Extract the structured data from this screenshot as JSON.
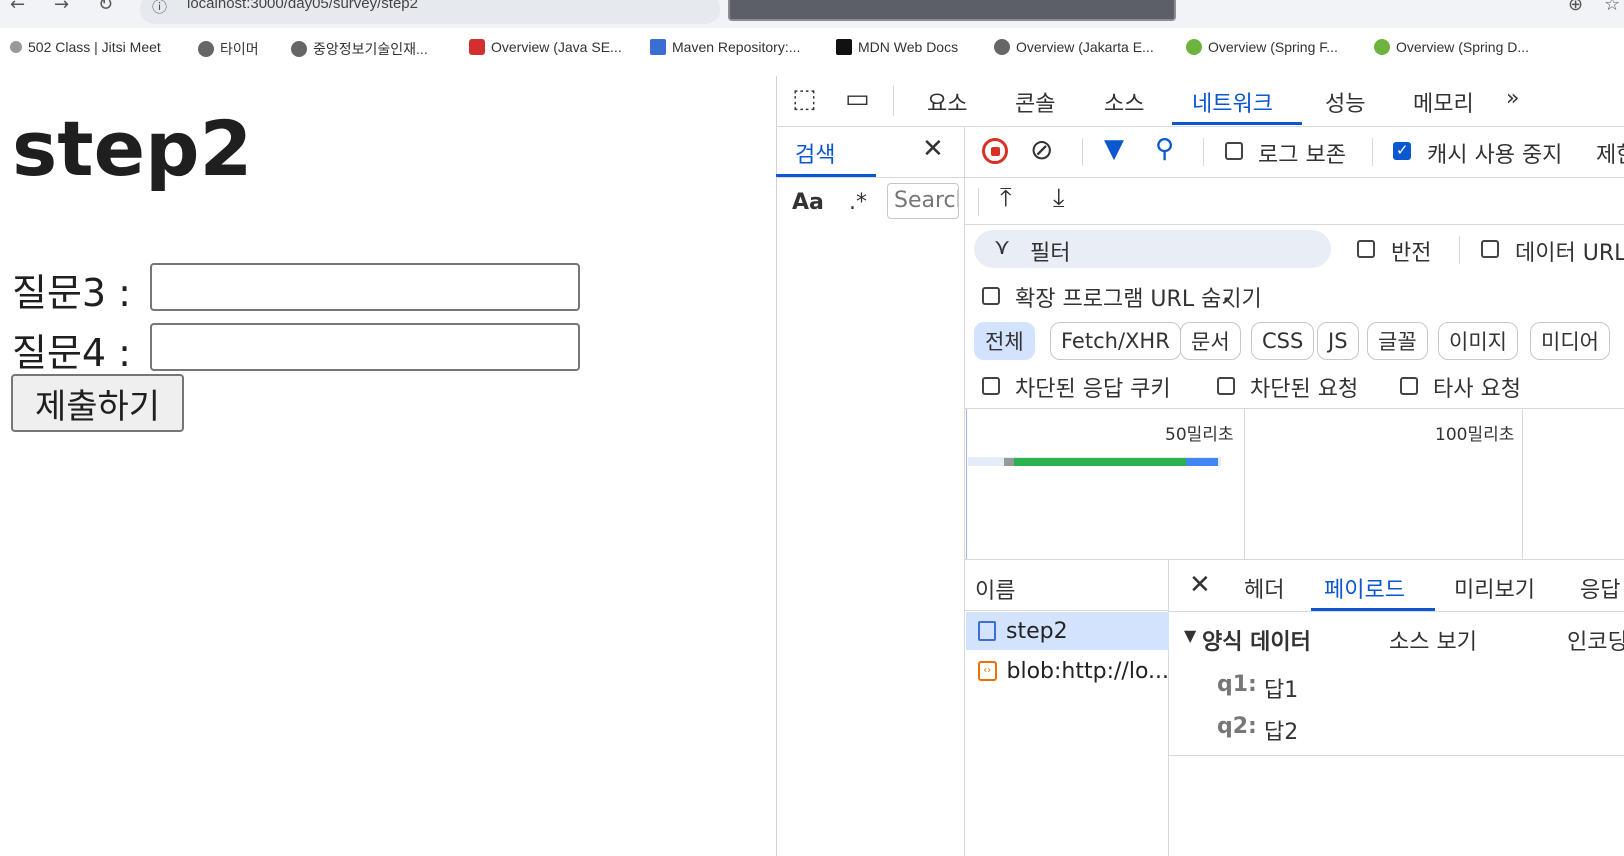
{
  "browser": {
    "url": "localhost:3000/day05/survey/step2",
    "bookmarks": [
      "502 Class | Jitsi Meet",
      "타이머",
      "중앙정보기술인재...",
      "Overview (Java SE...",
      "Maven Repository:...",
      "MDN Web Docs",
      "Overview (Jakarta E...",
      "Overview (Spring F...",
      "Overview (Spring D..."
    ]
  },
  "page": {
    "title": "step2",
    "q3_label": "질문3 :",
    "q4_label": "질문4 :",
    "submit_label": "제출하기"
  },
  "devtools": {
    "tabs": [
      "요소",
      "콘솔",
      "소스",
      "네트워크",
      "성능",
      "메모리"
    ],
    "active_tab": "네트워크",
    "search_panel": {
      "title": "검색",
      "case_label": "Aa",
      "regex_label": ".*",
      "placeholder": "Search"
    },
    "toolbar": {
      "preserve_log": "로그 보존",
      "disable_cache": "캐시 사용 중지",
      "disable_cache_checked": true,
      "throttle_partial": "제한"
    },
    "filter": {
      "placeholder": "필터",
      "invert": "반전",
      "hide_data_urls": "데이터 URL",
      "hide_extension_urls": "확장 프로그램 URL 숨기기"
    },
    "type_chips": [
      "전체",
      "Fetch/XHR",
      "문서",
      "CSS",
      "JS",
      "글꼴",
      "이미지",
      "미디어"
    ],
    "checkbox_row": [
      "차단된 응답 쿠키",
      "차단된 요청",
      "타사 요청"
    ],
    "timeline": {
      "ticks": [
        "50밀리초",
        "100밀리초"
      ]
    },
    "requests_header": "이름",
    "requests": [
      "step2",
      "blob:http://lo..."
    ],
    "detail_tabs": [
      "헤더",
      "페이로드",
      "미리보기",
      "응답"
    ],
    "active_detail_tab": "페이로드",
    "payload": {
      "section": "양식 데이터",
      "view_source": "소스 보기",
      "encoded_partial": "인코딩",
      "fields": [
        {
          "key": "q1:",
          "value": "답1"
        },
        {
          "key": "q2:",
          "value": "답2"
        }
      ]
    }
  }
}
